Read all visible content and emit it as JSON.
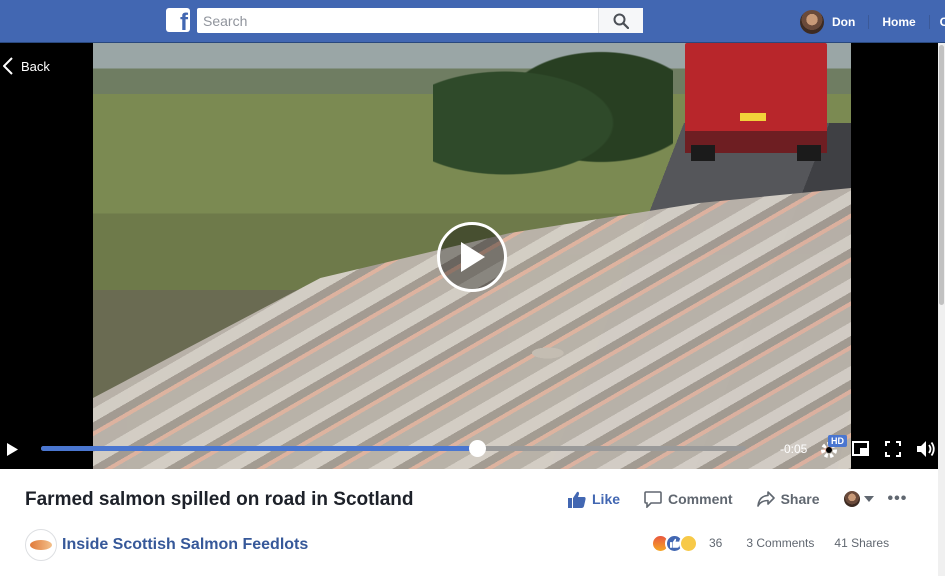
{
  "topbar": {
    "logo": "f",
    "search_placeholder": "Search",
    "user_name": "Don",
    "home_label": "Home",
    "more_label": "C",
    "brand_color": "#4267b2"
  },
  "video": {
    "back_label": "Back",
    "time_remaining": "-0:05",
    "progress": 0.619,
    "hd_label": "HD",
    "accent_color": "#4a76d0"
  },
  "post": {
    "title": "Farmed salmon spilled on road in Scotland",
    "actions": {
      "like": "Like",
      "comment": "Comment",
      "share": "Share",
      "more": "•••"
    },
    "page_name": "Inside Scottish Salmon Feedlots",
    "reactions": [
      "angry",
      "like",
      "sad"
    ],
    "reaction_count": "36",
    "comments": "3 Comments",
    "shares": "41 Shares"
  }
}
